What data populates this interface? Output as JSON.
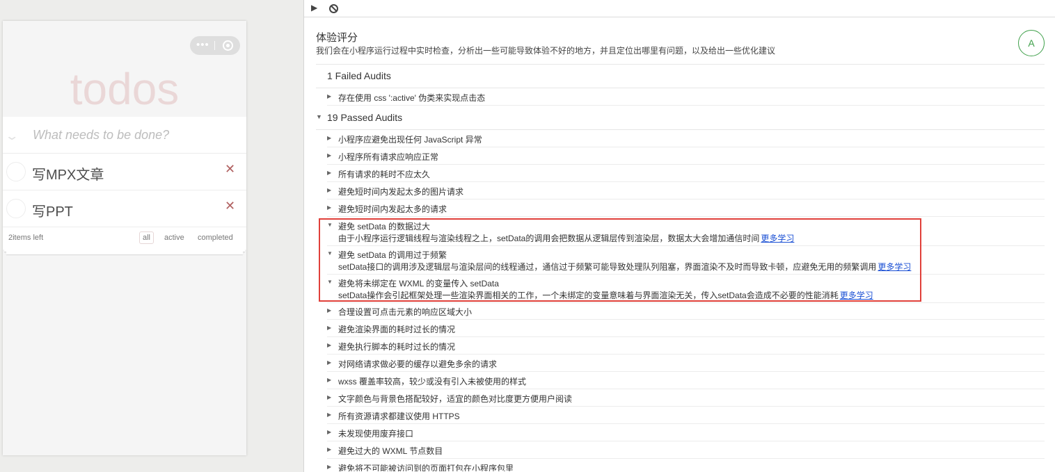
{
  "simulator": {
    "app_title": "todos",
    "new_todo_placeholder": "What needs to be done?",
    "todos": [
      {
        "text": "写MPX文章"
      },
      {
        "text": "写PPT"
      }
    ],
    "delete_glyph": "✕",
    "items_left": "2items left",
    "filters": [
      "all",
      "active",
      "completed"
    ]
  },
  "audit": {
    "title": "体验评分",
    "description": "我们会在小程序运行过程中实时检查，分析出一些可能导致体验不好的地方，并且定位出哪里有问题，以及给出一些优化建议",
    "grade": "A",
    "failed_group": "1 Failed Audits",
    "failed_items": [
      "存在使用 css ':active' 伪类来实现点击态"
    ],
    "passed_group": "19 Passed Audits",
    "passed_items_top": [
      "小程序应避免出现任何 JavaScript 异常",
      "小程序所有请求应响应正常",
      "所有请求的耗时不应太久",
      "避免短时间内发起太多的图片请求",
      "避免短时间内发起太多的请求"
    ],
    "expanded_items": [
      {
        "label": "避免 setData 的数据过大",
        "desc": "由于小程序运行逻辑线程与渲染线程之上，setData的调用会把数据从逻辑层传到渲染层，数据太大会增加通信时间",
        "link": "更多学习"
      },
      {
        "label": "避免 setData 的调用过于频繁",
        "desc": "setData接口的调用涉及逻辑层与渲染层间的线程通过，通信过于频繁可能导致处理队列阻塞，界面渲染不及时而导致卡顿，应避免无用的频繁调用",
        "link": "更多学习"
      },
      {
        "label": "避免将未绑定在 WXML 的变量传入 setData",
        "desc": "setData操作会引起框架处理一些渲染界面相关的工作，一个未绑定的变量意味着与界面渲染无关，传入setData会造成不必要的性能消耗",
        "link": "更多学习"
      }
    ],
    "passed_items_bottom": [
      "合理设置可点击元素的响应区域大小",
      "避免渲染界面的耗时过长的情况",
      "避免执行脚本的耗时过长的情况",
      "对网络请求做必要的缓存以避免多余的请求",
      "wxss 覆盖率较高，较少或没有引入未被使用的样式",
      "文字颜色与背景色搭配较好，适宜的颜色对比度更方便用户阅读",
      "所有资源请求都建议使用 HTTPS",
      "未发现使用废弃接口",
      "避免过大的 WXML 节点数目",
      "避免将不可能被访问到的页面打包在小程序包里"
    ]
  },
  "colors": {
    "grade_green": "#3fa04a",
    "highlight_red": "#e0403a",
    "link_blue": "#1a4fd4"
  },
  "icons": {
    "collapsed": "chevron-right-icon",
    "expanded": "chevron-down-icon",
    "run": "play-icon",
    "clear": "ban-icon"
  }
}
